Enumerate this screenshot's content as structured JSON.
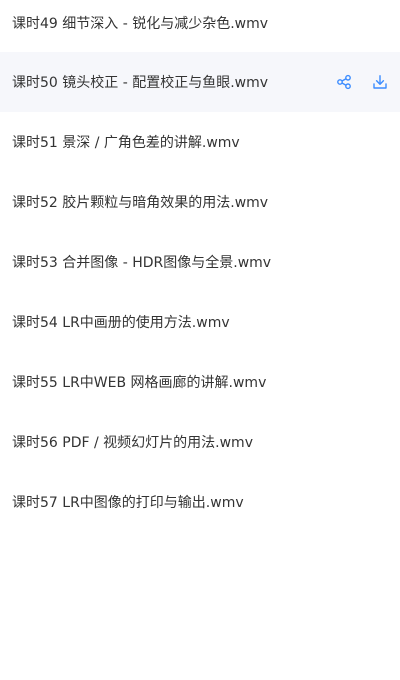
{
  "files": [
    {
      "name": "课时49 细节深入 - 锐化与减少杂色.wmv"
    },
    {
      "name": "课时50 镜头校正 - 配置校正与鱼眼.wmv",
      "hovered": true
    },
    {
      "name": "课时51 景深 / 广角色差的讲解.wmv"
    },
    {
      "name": "课时52 胶片颗粒与暗角效果的用法.wmv"
    },
    {
      "name": "课时53 合并图像 - HDR图像与全景.wmv"
    },
    {
      "name": "课时54 LR中画册的使用方法.wmv"
    },
    {
      "name": "课时55 LR中WEB 网格画廊的讲解.wmv"
    },
    {
      "name": "课时56 PDF / 视频幻灯片的用法.wmv"
    },
    {
      "name": "课时57 LR中图像的打印与输出.wmv"
    }
  ],
  "row_actions": {
    "share_icon": "share-icon",
    "download_icon": "download-icon"
  },
  "colors": {
    "text": "#333333",
    "hover_background": "#f6f7fb",
    "icon_accent": "#3b8cff"
  }
}
